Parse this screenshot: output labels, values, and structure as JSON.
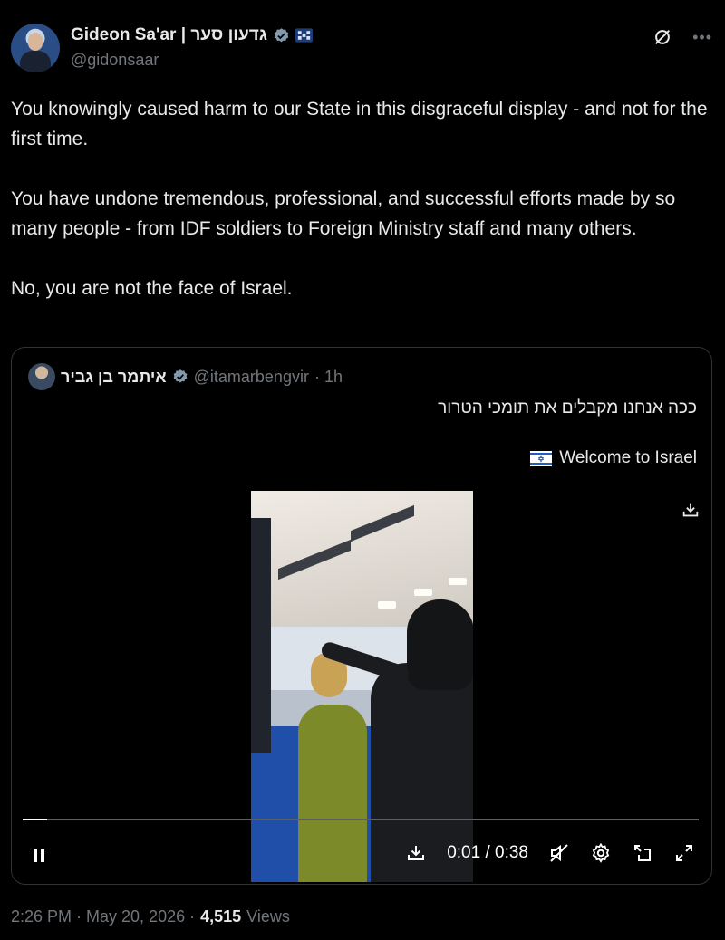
{
  "author": {
    "display_name": "Gideon Sa'ar | גדעון סער",
    "handle": "@gidonsaar"
  },
  "header_icons": [
    "verified-badge-icon",
    "flag-badge-icon",
    "grok-icon",
    "more-icon"
  ],
  "tweet": {
    "paragraphs": [
      "You knowingly caused harm to our State in this disgraceful display - and not for the first time.",
      "You have undone tremendous, professional, and successful efforts made by so many people - from IDF soldiers to Foreign Ministry staff and many others.",
      "No, you are not the face of Israel."
    ]
  },
  "quote": {
    "display_name": "איתמר בן גביר",
    "handle": "@itamarbengvir",
    "time": "· 1h",
    "line1": "ככה אנחנו מקבלים את תומכי הטרור",
    "line2": "Welcome to Israel"
  },
  "video": {
    "time": "0:01 / 0:38",
    "progress_fraction": 0.036
  },
  "meta": {
    "time": "2:26 PM · May 20, 2026 ·",
    "views_count": "4,515",
    "views_label": "Views"
  },
  "colors": {
    "background": "#000000",
    "text": "#e7e9ea",
    "secondary": "#71767b",
    "verified": "#829aab",
    "border": "#2f3336"
  }
}
